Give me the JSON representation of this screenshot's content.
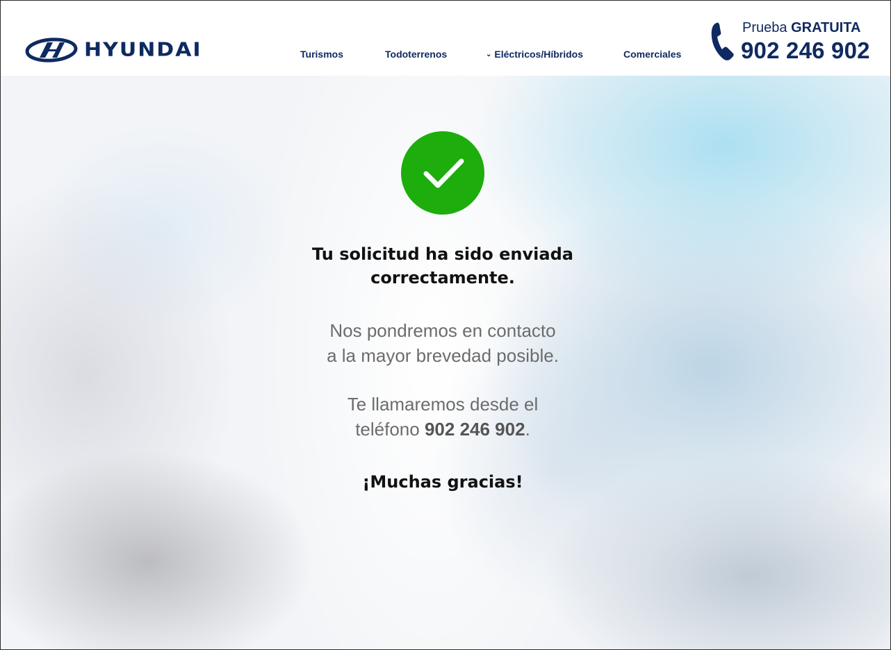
{
  "header": {
    "logo_text": "HYUNDAI",
    "nav": [
      {
        "label": "Turismos"
      },
      {
        "label": "Todoterrenos"
      },
      {
        "label": "Eléctricos/Híbridos"
      },
      {
        "label": "Comerciales"
      }
    ],
    "phone": {
      "prefix": "Prueba",
      "highlight": "GRATUITA",
      "number": "902 246 902"
    }
  },
  "main": {
    "headline_line1": "Tu solicitud ha sido enviada",
    "headline_line2": "correctamente.",
    "sub1_line1": "Nos pondremos en contacto",
    "sub1_line2": "a la mayor brevedad posible.",
    "sub2_line1": "Te llamaremos desde el",
    "sub2_line2_prefix": "teléfono",
    "sub2_number": "902 246 902",
    "sub2_suffix": ".",
    "thanks": "¡Muchas gracias!"
  },
  "colors": {
    "brand": "#0f2a60",
    "success": "#1dad0c"
  },
  "icons": [
    "hyundai-logo-icon",
    "chevron-down-icon",
    "phone-icon",
    "check-icon"
  ]
}
